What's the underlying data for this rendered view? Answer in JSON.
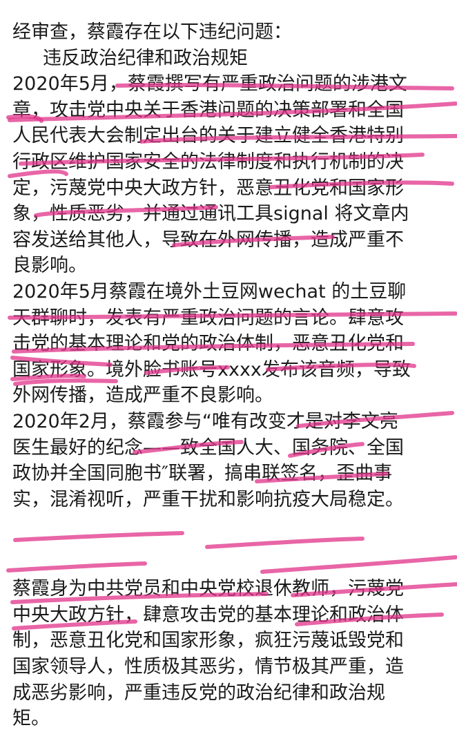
{
  "document": {
    "intro": "经审查，蔡霞存在以下违纪问题：",
    "heading": "违反政治纪律和政治规矩",
    "paragraph1": [
      "2020年5月，蔡霞撰写有严重政治问题的涉港文",
      "章，攻击党中央关于香港问题的决策部署和全国",
      "人民代表大会制定出台的关于建立健全香港特别",
      "行政区维护国家安全的法律制度和执行机制的决",
      "定，污蔑党中央大政方针，恶意丑化党和国家形",
      "象，性质恶劣，并通过通讯工具signal 将文章内",
      "容发送给其他人，导致在外网传播，造成严重不",
      "良影响。"
    ],
    "paragraph2": [
      "2020年5月蔡霞在境外土豆网wechat 的土豆聊",
      "天群聊时，发表有严重政治问题的言论。肆意攻",
      "击党的基本理论和党的政治体制，恶意丑化党和",
      "国家形象。境外脸书账号xxxx发布该音频，导致",
      "外网传播，造成严重不良影响。"
    ],
    "paragraph3": [
      "2020年2月，蔡霞参与“唯有改变才是对李文亮",
      "医生最好的纪念——致全国人大、国务院、全国",
      "政协并全国同胞书″联署，搞串联签名，歪曲事",
      "实，混淆视听，严重干扰和影响抗疫大局稳定。"
    ],
    "paragraph4": [
      "蔡霞身为中共党员和中央党校退休教师，污蔑党",
      "中央大政方针，肆意攻击党的基本理论和政治体",
      "制，恶意丑化党和国家形象，疯狂污蔑诋毁党和",
      "国家领导人，性质极其恶劣，情节极其严重，造",
      "成恶劣影响，严重违反党的政治纪律和政治规",
      "矩。"
    ]
  },
  "colors": {
    "text": "#1a1a1a",
    "highlight_stroke": "#e0338a"
  }
}
